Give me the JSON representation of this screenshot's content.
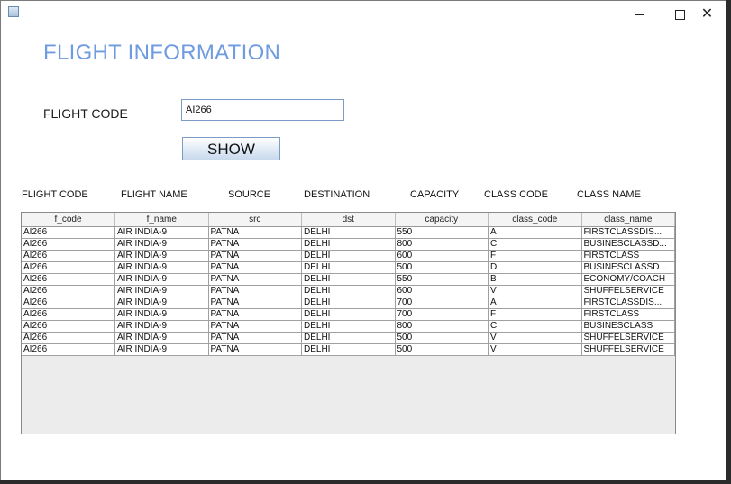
{
  "window": {
    "controls": {
      "minimize": "minimize",
      "maximize": "maximize",
      "close": "close"
    }
  },
  "heading": "FLIGHT INFORMATION",
  "search": {
    "label": "FLIGHT CODE",
    "value": "AI266",
    "button_label": "SHOW"
  },
  "column_labels": [
    "FLIGHT CODE",
    "FLIGHT NAME",
    "SOURCE",
    "DESTINATION",
    "CAPACITY",
    "CLASS CODE",
    "CLASS NAME"
  ],
  "table": {
    "headers": [
      "f_code",
      "f_name",
      "src",
      "dst",
      "capacity",
      "class_code",
      "class_name"
    ],
    "rows": [
      [
        "AI266",
        "AIR INDIA-9",
        "PATNA",
        "DELHI",
        "550",
        "A",
        "FIRSTCLASSDIS..."
      ],
      [
        "AI266",
        "AIR INDIA-9",
        "PATNA",
        "DELHI",
        "800",
        "C",
        "BUSINESCLASSD..."
      ],
      [
        "AI266",
        "AIR INDIA-9",
        "PATNA",
        "DELHI",
        "600",
        "F",
        "FIRSTCLASS"
      ],
      [
        "AI266",
        "AIR INDIA-9",
        "PATNA",
        "DELHI",
        "500",
        "D",
        "BUSINESCLASSD..."
      ],
      [
        "AI266",
        "AIR INDIA-9",
        "PATNA",
        "DELHI",
        "550",
        "B",
        "ECONOMY/COACH"
      ],
      [
        "AI266",
        "AIR INDIA-9",
        "PATNA",
        "DELHI",
        "600",
        "V",
        "SHUFFELSERVICE"
      ],
      [
        "AI266",
        "AIR INDIA-9",
        "PATNA",
        "DELHI",
        "700",
        "A",
        "FIRSTCLASSDIS..."
      ],
      [
        "AI266",
        "AIR INDIA-9",
        "PATNA",
        "DELHI",
        "700",
        "F",
        "FIRSTCLASS"
      ],
      [
        "AI266",
        "AIR INDIA-9",
        "PATNA",
        "DELHI",
        "800",
        "C",
        "BUSINESCLASS"
      ],
      [
        "AI266",
        "AIR INDIA-9",
        "PATNA",
        "DELHI",
        "500",
        "V",
        "SHUFFELSERVICE"
      ],
      [
        "AI266",
        "AIR INDIA-9",
        "PATNA",
        "DELHI",
        "500",
        "V",
        "SHUFFELSERVICE"
      ]
    ]
  }
}
